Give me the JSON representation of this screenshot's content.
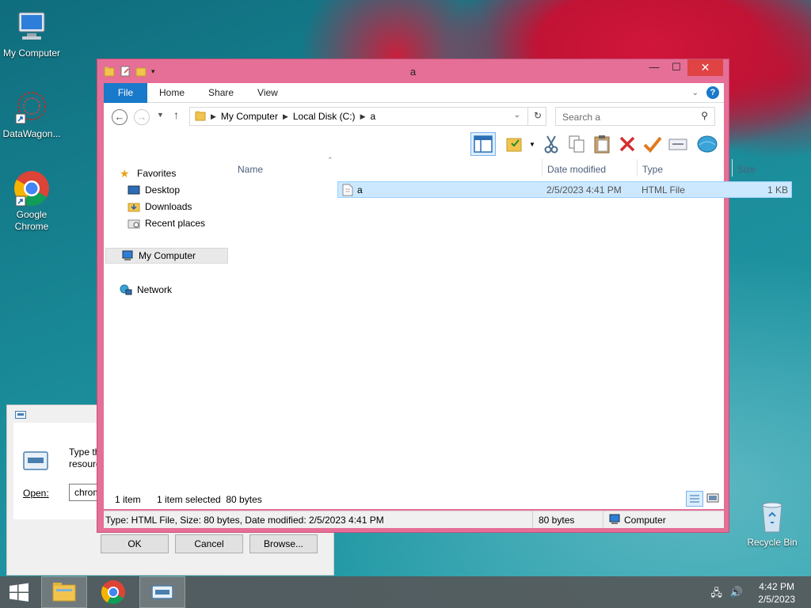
{
  "desktop": {
    "icons": [
      {
        "label": "My Computer"
      },
      {
        "label": "DataWagon..."
      },
      {
        "label": "Google\nChrome"
      },
      {
        "label": "Recycle Bin"
      }
    ]
  },
  "run_dialog": {
    "text": "Type the\nresource",
    "open_label": "Open:",
    "open_value": "chrome",
    "ok": "OK",
    "cancel": "Cancel",
    "browse": "Browse..."
  },
  "window": {
    "title": "a",
    "ribbon": {
      "tabs": [
        "File",
        "Home",
        "Share",
        "View"
      ]
    },
    "address": {
      "segments": [
        "My Computer",
        "Local Disk (C:)",
        "a"
      ],
      "search_placeholder": "Search a"
    },
    "nav": {
      "favorites": "Favorites",
      "desktop": "Desktop",
      "downloads": "Downloads",
      "recent": "Recent places",
      "my_computer": "My Computer",
      "network": "Network"
    },
    "columns": [
      "Name",
      "Date modified",
      "Type",
      "Size"
    ],
    "files": [
      {
        "name": "a",
        "date": "2/5/2023 4:41 PM",
        "type": "HTML File",
        "size": "1 KB"
      }
    ],
    "status": {
      "count": "1 item",
      "selected": "1 item selected  80 bytes"
    },
    "details": {
      "info": "Type: HTML File, Size: 80 bytes, Date modified: 2/5/2023 4:41 PM",
      "size": "80 bytes",
      "location": "Computer"
    }
  },
  "taskbar": {
    "time": "4:42 PM",
    "date": "2/5/2023"
  },
  "colors": {
    "window_frame": "#e56f97",
    "file_tab": "#1979ca",
    "selection": "#cce8ff"
  }
}
